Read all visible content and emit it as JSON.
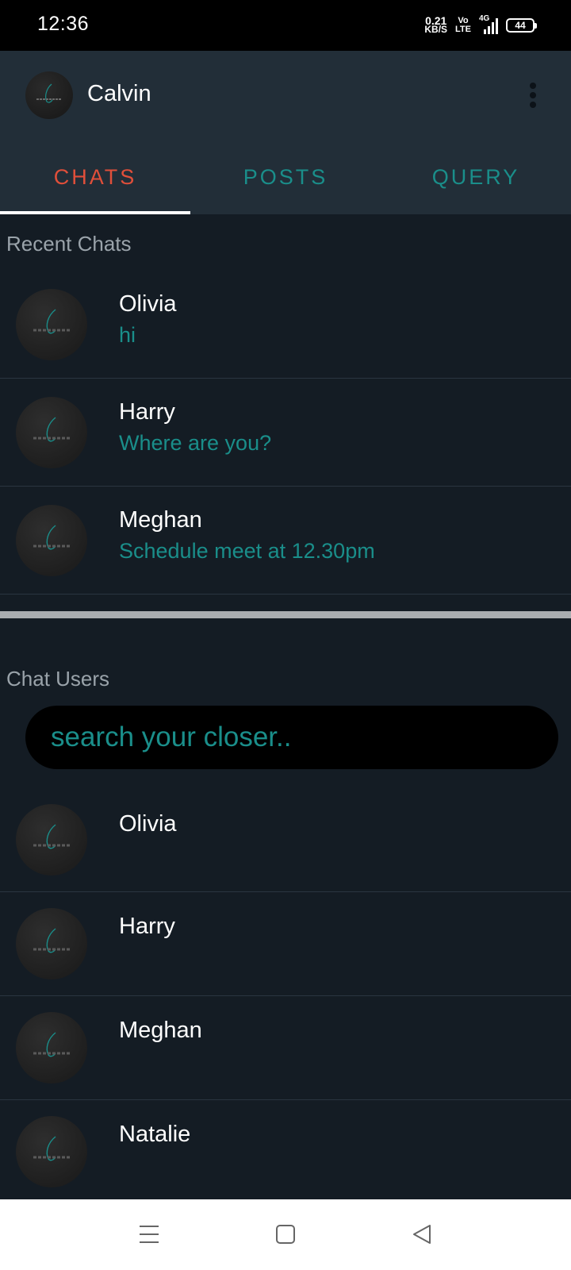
{
  "status_bar": {
    "time": "12:36",
    "net_speed_value": "0.21",
    "net_speed_unit": "KB/S",
    "volte_top": "Vo",
    "volte_bottom": "LTE",
    "network": "4G",
    "battery": "44"
  },
  "header": {
    "user_name": "Calvin",
    "menu_icon": "more-vert-icon"
  },
  "tabs": [
    {
      "label": "CHATS",
      "active": true
    },
    {
      "label": "POSTS",
      "active": false
    },
    {
      "label": "QUERY",
      "active": false
    }
  ],
  "recent_chats": {
    "title": "Recent Chats",
    "items": [
      {
        "name": "Olivia",
        "message": "hi"
      },
      {
        "name": "Harry",
        "message": "Where are you?"
      },
      {
        "name": "Meghan",
        "message": "Schedule meet at 12.30pm"
      }
    ]
  },
  "chat_users": {
    "title": "Chat Users",
    "search_placeholder": "search your closer..",
    "items": [
      {
        "name": "Olivia"
      },
      {
        "name": "Harry"
      },
      {
        "name": "Meghan"
      },
      {
        "name": "Natalie"
      }
    ]
  },
  "colors": {
    "accent_teal": "#1a8e8a",
    "active_tab": "#e04f3a",
    "background": "#141c24",
    "header": "#222e38"
  },
  "nav_bar": {
    "icons": [
      "menu-icon",
      "home-square-icon",
      "back-triangle-icon"
    ]
  }
}
